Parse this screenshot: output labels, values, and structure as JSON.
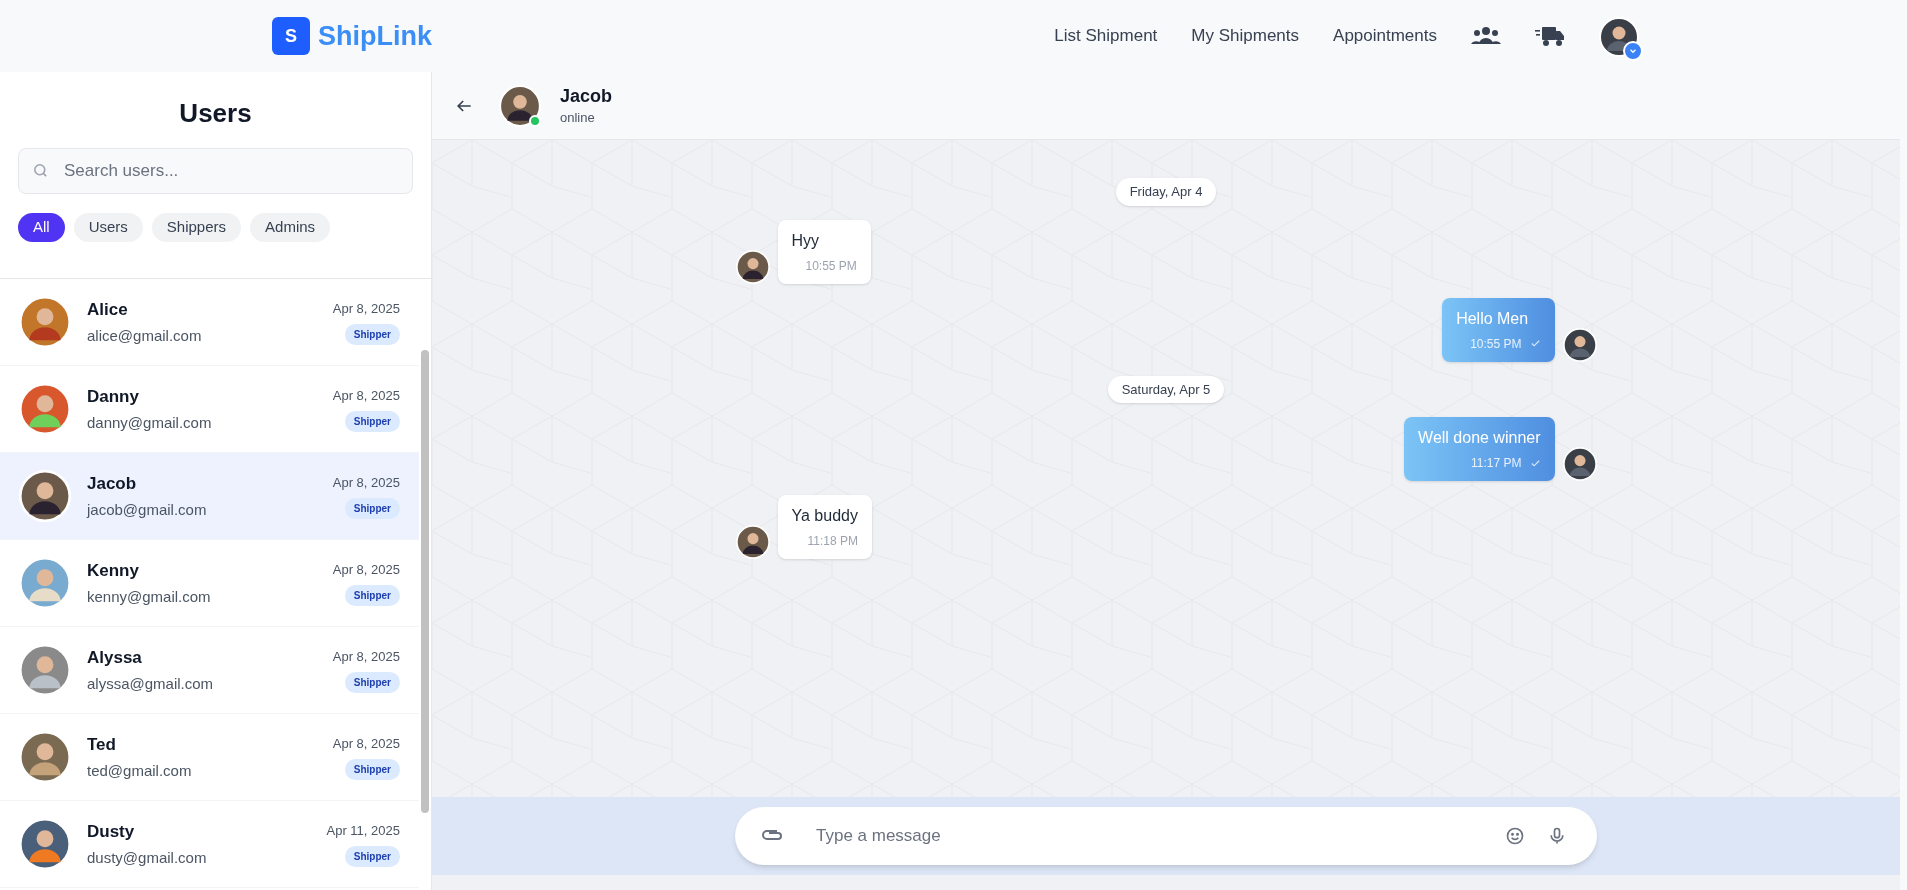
{
  "app": {
    "logo_letter": "S",
    "name": "ShipLink"
  },
  "nav": [
    {
      "label": "List Shipment"
    },
    {
      "label": "My Shipments"
    },
    {
      "label": "Appointments"
    }
  ],
  "sidebar": {
    "title": "Users",
    "search": {
      "placeholder": "Search users..."
    },
    "filters": [
      {
        "label": "All",
        "selected": true
      },
      {
        "label": "Users",
        "selected": false
      },
      {
        "label": "Shippers",
        "selected": false
      },
      {
        "label": "Admins",
        "selected": false
      }
    ],
    "users": [
      {
        "name": "Alice",
        "email": "alice@gmail.com",
        "date": "Apr 8, 2025",
        "role": "Shipper",
        "selected": false
      },
      {
        "name": "Danny",
        "email": "danny@gmail.com",
        "date": "Apr 8, 2025",
        "role": "Shipper",
        "selected": false
      },
      {
        "name": "Jacob",
        "email": "jacob@gmail.com",
        "date": "Apr 8, 2025",
        "role": "Shipper",
        "selected": true
      },
      {
        "name": "Kenny",
        "email": "kenny@gmail.com",
        "date": "Apr 8, 2025",
        "role": "Shipper",
        "selected": false
      },
      {
        "name": "Alyssa",
        "email": "alyssa@gmail.com",
        "date": "Apr 8, 2025",
        "role": "Shipper",
        "selected": false
      },
      {
        "name": "Ted",
        "email": "ted@gmail.com",
        "date": "Apr 8, 2025",
        "role": "Shipper",
        "selected": false
      },
      {
        "name": "Dusty",
        "email": "dusty@gmail.com",
        "date": "Apr 11, 2025",
        "role": "Shipper",
        "selected": false
      }
    ]
  },
  "chat": {
    "contact": {
      "name": "Jacob",
      "status": "online",
      "online": true
    },
    "messages": [
      {
        "kind": "date",
        "text": "Friday, Apr 4"
      },
      {
        "kind": "incoming",
        "text": "Hyy",
        "time": "10:55 PM"
      },
      {
        "kind": "outgoing",
        "text": "Hello Men",
        "time": "10:55 PM"
      },
      {
        "kind": "date",
        "text": "Saturday, Apr 5"
      },
      {
        "kind": "outgoing",
        "text": "Well done winner",
        "time": "11:17 PM"
      },
      {
        "kind": "incoming",
        "text": "Ya buddy",
        "time": "11:18 PM"
      }
    ],
    "composer": {
      "placeholder": "Type a message"
    }
  }
}
